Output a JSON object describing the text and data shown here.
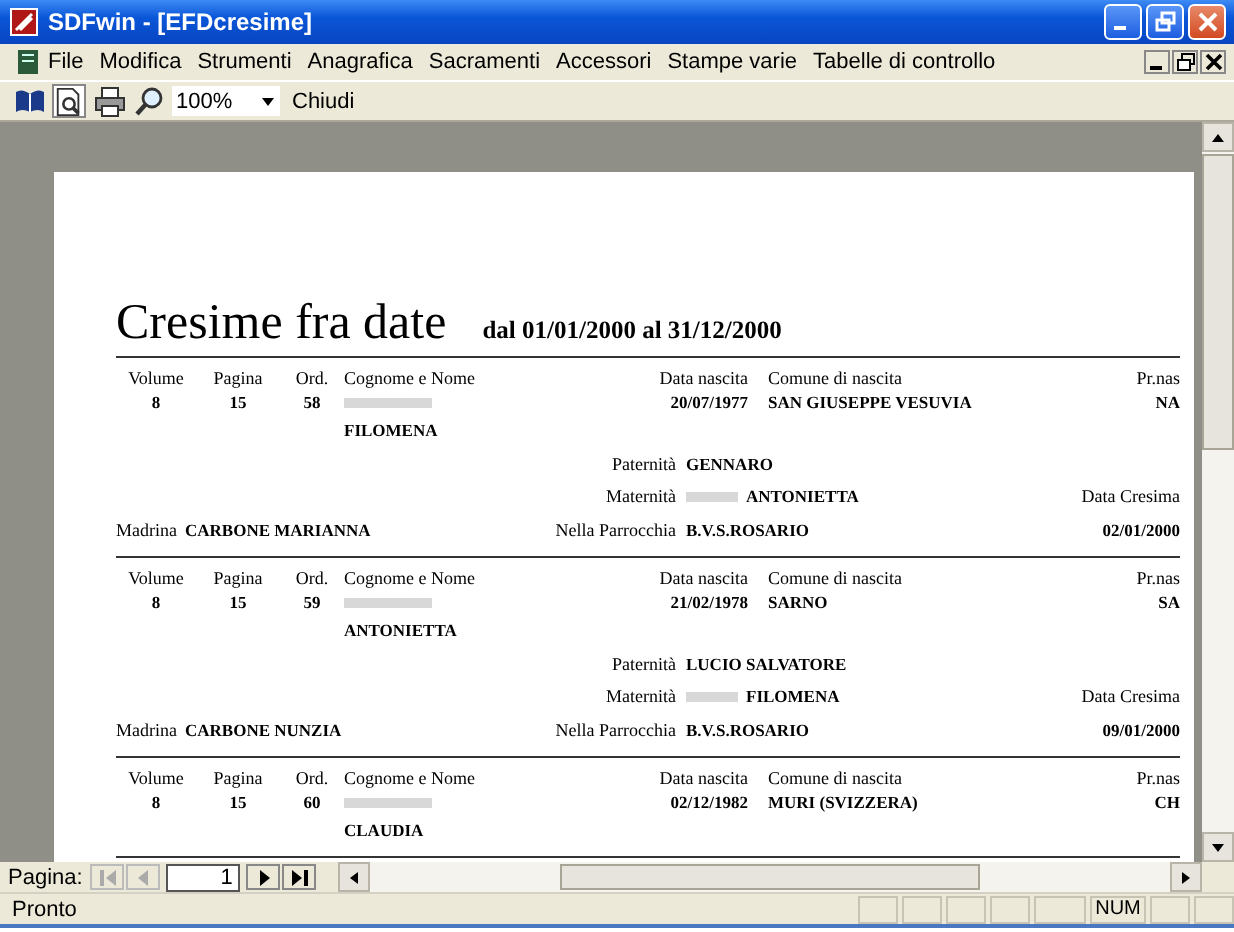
{
  "window": {
    "title": "SDFwin - [EFDcresime]"
  },
  "menu": [
    "File",
    "Modifica",
    "Strumenti",
    "Anagrafica",
    "Sacramenti",
    "Accessori",
    "Stampe varie",
    "Tabelle di controllo"
  ],
  "toolbar": {
    "zoom": "100%",
    "close_label": "Chiudi"
  },
  "report": {
    "title": "Cresime fra date",
    "range": "dal 01/01/2000 al 31/12/2000",
    "records": [
      {
        "labels": {
          "volume": "Volume",
          "page": "Pagina",
          "ord": "Ord.",
          "name": "Cognome e Nome",
          "birth_date": "Data nascita",
          "birth_place": "Comune di nascita",
          "province": "Pr.nas"
        },
        "volume": "8",
        "page": "15",
        "ord": "58",
        "given_name": "FILOMENA",
        "birth_date": "20/07/1977",
        "birth_place": "SAN GIUSEPPE VESUVIA",
        "province": "NA",
        "paternity_label": "Paternità",
        "paternity": "GENNARO",
        "maternity_label": "Maternità",
        "maternity": "ANTONIETTA",
        "sponsor_label": "Madrina",
        "sponsor": "CARBONE MARIANNA",
        "parish_label": "Nella Parrocchia",
        "parish": "B.V.S.ROSARIO",
        "confirmation_label": "Data Cresima",
        "confirmation_date": "02/01/2000"
      },
      {
        "labels": {
          "volume": "Volume",
          "page": "Pagina",
          "ord": "Ord.",
          "name": "Cognome e Nome",
          "birth_date": "Data nascita",
          "birth_place": "Comune di nascita",
          "province": "Pr.nas"
        },
        "volume": "8",
        "page": "15",
        "ord": "59",
        "given_name": "ANTONIETTA",
        "birth_date": "21/02/1978",
        "birth_place": "SARNO",
        "province": "SA",
        "paternity_label": "Paternità",
        "paternity": "LUCIO SALVATORE",
        "maternity_label": "Maternità",
        "maternity": "FILOMENA",
        "sponsor_label": "Madrina",
        "sponsor": "CARBONE NUNZIA",
        "parish_label": "Nella Parrocchia",
        "parish": "B.V.S.ROSARIO",
        "confirmation_label": "Data Cresima",
        "confirmation_date": "09/01/2000"
      },
      {
        "labels": {
          "volume": "Volume",
          "page": "Pagina",
          "ord": "Ord.",
          "name": "Cognome e Nome",
          "birth_date": "Data nascita",
          "birth_place": "Comune di nascita",
          "province": "Pr.nas"
        },
        "volume": "8",
        "page": "15",
        "ord": "60",
        "given_name": "CLAUDIA",
        "birth_date": "02/12/1982",
        "birth_place": "MURI (SVIZZERA)",
        "province": "CH"
      }
    ]
  },
  "navigator": {
    "label": "Pagina:",
    "page": "1",
    "buttons": [
      {
        "kind": "first",
        "disabled": true
      },
      {
        "kind": "prev",
        "disabled": true
      },
      {
        "kind": "next",
        "disabled": false
      },
      {
        "kind": "last",
        "disabled": false
      }
    ]
  },
  "status_bar": {
    "text": "Pronto",
    "indicator": "NUM"
  }
}
